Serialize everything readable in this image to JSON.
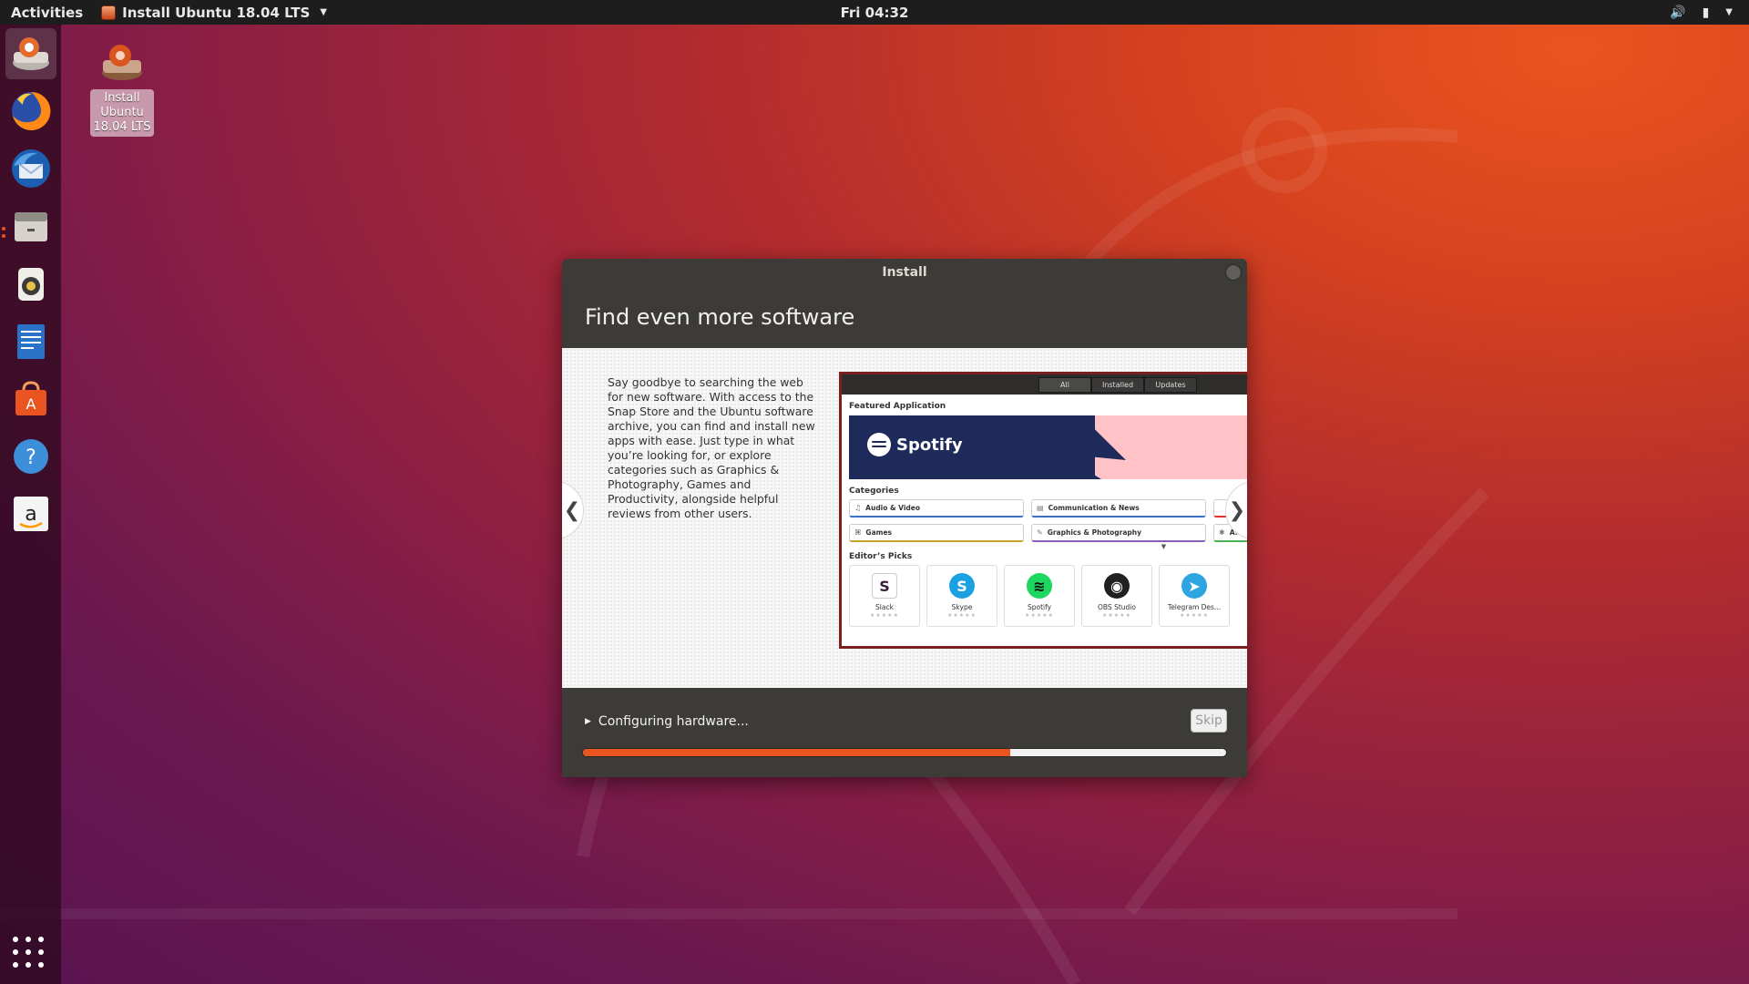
{
  "topbar": {
    "activities": "Activities",
    "app_title": "Install Ubuntu 18.04 LTS",
    "clock": "Fri 04:32"
  },
  "dock": {
    "items": [
      {
        "icon": "installer-icon",
        "active": true
      },
      {
        "icon": "firefox-icon"
      },
      {
        "icon": "thunderbird-icon"
      },
      {
        "icon": "files-icon"
      },
      {
        "icon": "rhythmbox-icon"
      },
      {
        "icon": "writer-icon"
      },
      {
        "icon": "software-icon"
      },
      {
        "icon": "help-icon"
      },
      {
        "icon": "amazon-icon"
      }
    ]
  },
  "desktop": {
    "icon_label": "Install Ubuntu 18.04 LTS"
  },
  "window": {
    "title": "Install",
    "heading": "Find even more software",
    "slide_text": "Say goodbye to searching the web for new software. With access to the Snap Store and the Ubuntu software archive, you can find and install new apps with ease. Just type in what you’re looking for, or explore categories such as Graphics & Photography, Games and Productivity, alongside helpful reviews from other users.",
    "prev_arrow": "❮",
    "next_arrow": "❯",
    "screenshot": {
      "tabs": [
        "All",
        "Installed",
        "Updates"
      ],
      "featured_label": "Featured Application",
      "featured_app": "Spotify",
      "categories_label": "Categories",
      "categories": [
        "Audio & Video",
        "Communication & News",
        "",
        "Games",
        "Graphics & Photography",
        "A..."
      ],
      "editors_picks_label": "Editor’s Picks",
      "picks": [
        "Slack",
        "Skype",
        "Spotify",
        "OBS Studio",
        "Telegram Des..."
      ]
    },
    "status_text": "Configuring hardware...",
    "skip_label": "Skip",
    "progress_fraction": 0.665
  },
  "colors": {
    "accent": "#e95420",
    "window_bg": "#3c3b37",
    "topbar_bg": "#1d1d1d"
  }
}
